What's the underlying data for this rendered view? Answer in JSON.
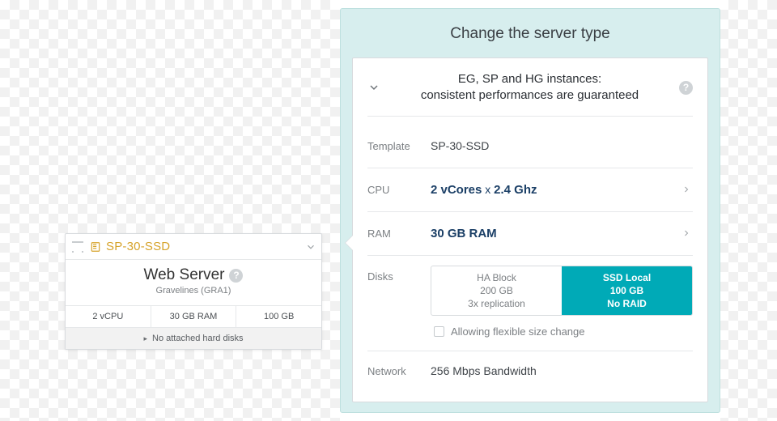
{
  "card": {
    "template_name": "SP-30-SSD",
    "server_name": "Web Server",
    "location": "Gravelines (GRA1)",
    "specs": {
      "cpu": "2 vCPU",
      "ram": "30 GB RAM",
      "disk": "100 GB"
    },
    "footer": "No attached hard disks"
  },
  "panel": {
    "title": "Change the server type",
    "expander_title": "EG, SP and HG instances:\nconsistent performances are guaranteed",
    "rows": {
      "template": {
        "label": "Template",
        "value": "SP-30-SSD"
      },
      "cpu": {
        "label": "CPU",
        "value_cores": "2 vCores",
        "value_mid": " x ",
        "value_freq": "2.4 Ghz"
      },
      "ram": {
        "label": "RAM",
        "value": "30 GB RAM"
      },
      "disks": {
        "label": "Disks",
        "opt_a": {
          "line1": "HA Block",
          "line2": "200 GB",
          "line3": "3x replication",
          "active": false
        },
        "opt_b": {
          "line1": "SSD Local",
          "line2": "100 GB",
          "line3": "No RAID",
          "active": true
        },
        "flex_label": "Allowing flexible size change"
      },
      "network": {
        "label": "Network",
        "value": "256 Mbps Bandwidth"
      }
    }
  }
}
